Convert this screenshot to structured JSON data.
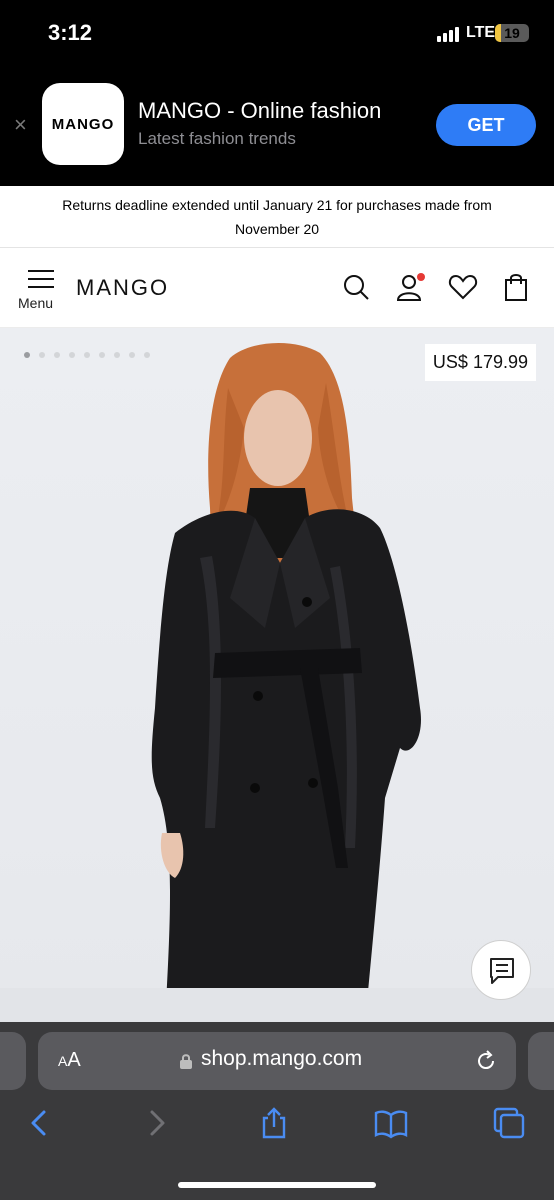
{
  "status_bar": {
    "time": "3:12",
    "network": "LTE",
    "battery": "19",
    "battery_level": 0.19
  },
  "app_banner": {
    "icon_text": "MANGO",
    "name": "MANGO - Online fashion",
    "subtitle": "Latest fashion trends",
    "get_label": "GET"
  },
  "notice": {
    "text": "Returns deadline extended until January 21 for purchases made from November 20"
  },
  "header": {
    "menu_label": "Menu",
    "logo": "MANGO"
  },
  "product": {
    "price": "US$ 179.99",
    "image_count": 9,
    "active_image": 1
  },
  "browser": {
    "text_size_label_small": "A",
    "text_size_label_large": "A",
    "url": "shop.mango.com"
  },
  "colors": {
    "accent": "#2e7cf6",
    "browser_icon": "#4a8cf2",
    "notification_dot": "#e53935"
  },
  "icons": [
    "close-icon",
    "hamburger-icon",
    "search-icon",
    "account-icon",
    "heart-icon",
    "shopping-bag-icon",
    "chat-icon",
    "lock-icon",
    "reload-icon",
    "back-icon",
    "forward-icon",
    "share-icon",
    "bookmarks-icon",
    "tabs-icon"
  ]
}
